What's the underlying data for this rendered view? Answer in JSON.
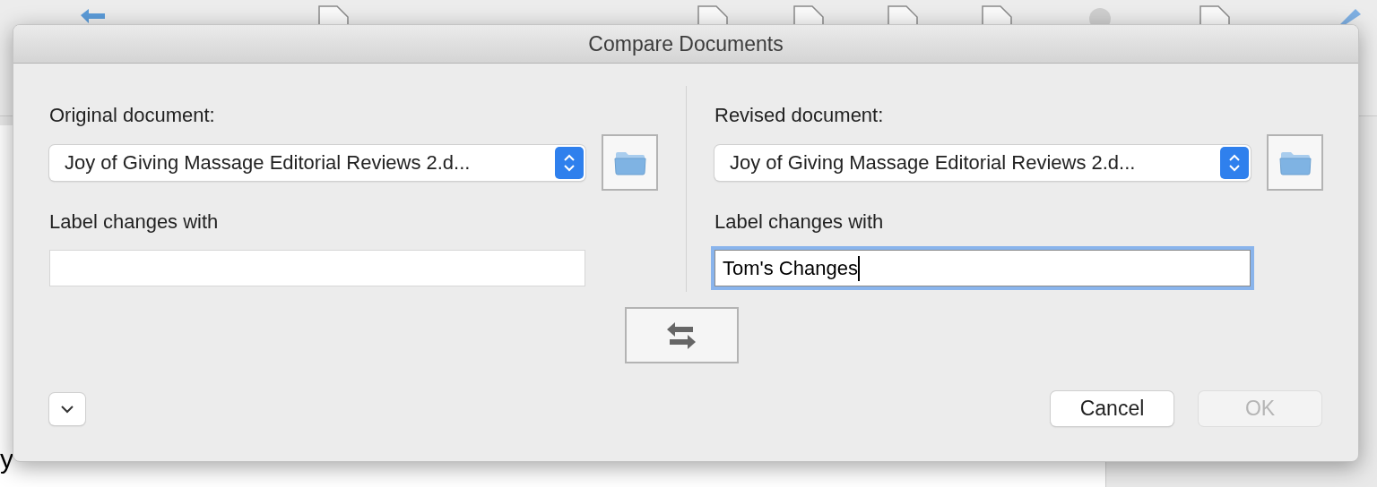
{
  "background_text": "y",
  "dialog": {
    "title": "Compare Documents",
    "original": {
      "heading": "Original document:",
      "document": "Joy of Giving Massage Editorial Reviews 2.d...",
      "label_heading": "Label changes with",
      "focused": false
    },
    "revised": {
      "heading": "Revised document:",
      "document": "Joy of Giving Massage Editorial Reviews 2.d...",
      "label_heading": "Label changes with",
      "label_value": "Tom's Changes",
      "focused": true
    },
    "options_expanded": false,
    "buttons": [
      {
        "label": "Cancel",
        "disabled": false
      },
      {
        "label": "OK",
        "disabled": true
      }
    ]
  }
}
